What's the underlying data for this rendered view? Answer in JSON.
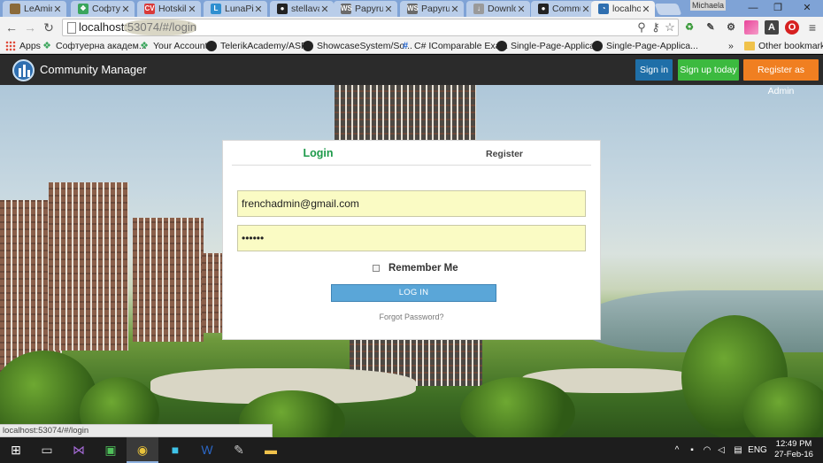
{
  "browser": {
    "tabs": [
      {
        "title": "LeAmino",
        "favicon_color": "#8a6a3a",
        "favicon_glyph": ""
      },
      {
        "title": "Софтуер",
        "favicon_color": "#3aa55c",
        "favicon_glyph": "❖"
      },
      {
        "title": "Hotskills",
        "favicon_color": "#d93a3a",
        "favicon_glyph": "CV"
      },
      {
        "title": "LunaPic",
        "favicon_color": "#2f8fd0",
        "favicon_glyph": "L"
      },
      {
        "title": "stellaval",
        "favicon_color": "#222222",
        "favicon_glyph": "●"
      },
      {
        "title": "Papyrus",
        "favicon_color": "#6a6a6a",
        "favicon_glyph": "WS"
      },
      {
        "title": "Papyrus",
        "favicon_color": "#6a6a6a",
        "favicon_glyph": "WS"
      },
      {
        "title": "Downloa",
        "favicon_color": "#9a9a9a",
        "favicon_glyph": "↓"
      },
      {
        "title": "Commun",
        "favicon_color": "#222222",
        "favicon_glyph": "●"
      },
      {
        "title": "localhost",
        "favicon_color": "#2f6fb0",
        "favicon_glyph": "◔"
      }
    ],
    "active_tab_index": 9,
    "profile_name": "Michaela",
    "window_controls": {
      "minimize": "—",
      "restore": "❐",
      "close": "✕"
    },
    "address": {
      "host": "localhost",
      "rest": ":53074/#/login"
    },
    "bookmarks": [
      {
        "label": "Apps",
        "icon": "apps-grid-icon"
      },
      {
        "label": "Софтуерна академ...",
        "icon": "telerik-icon"
      },
      {
        "label": "Your Account",
        "icon": "telerik-icon"
      },
      {
        "label": "TelerikAcademy/ASP...",
        "icon": "github-icon"
      },
      {
        "label": "ShowcaseSystem/So...",
        "icon": "github-icon"
      },
      {
        "label": "C# IComparable Exa...",
        "icon": "csharp-icon"
      },
      {
        "label": "Single-Page-Applica...",
        "icon": "github-icon"
      },
      {
        "label": "Single-Page-Applica...",
        "icon": "github-icon"
      }
    ],
    "bookmarks_overflow": "»",
    "other_bookmarks": "Other bookmarks"
  },
  "site": {
    "brand": "Community Manager",
    "nav": {
      "sign_in": "Sign in",
      "sign_up": "Sign up today",
      "register_admin": "Register as Admin"
    },
    "colors": {
      "sign_in": "#1f6fa8",
      "sign_up": "#3cba3f",
      "register_admin": "#f07f21",
      "login_tab": "#1d9a4a"
    }
  },
  "login": {
    "tab_login": "Login",
    "tab_register": "Register",
    "email_value": "frenchadmin@gmail.com",
    "password_value": "••••••",
    "remember_me": "Remember Me",
    "login_button": "LOG IN",
    "forgot_password": "Forgot Password?"
  },
  "status_bar": "localhost:53074/#/login",
  "taskbar": {
    "language": "ENG",
    "time": "12:49 PM",
    "date": "27-Feb-16"
  }
}
